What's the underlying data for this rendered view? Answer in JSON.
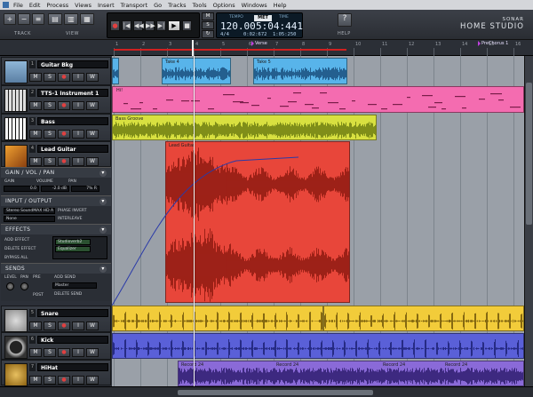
{
  "menu": [
    "File",
    "Edit",
    "Process",
    "Views",
    "Insert",
    "Transport",
    "Go",
    "Tracks",
    "Tools",
    "Options",
    "Windows",
    "Help"
  ],
  "toolbar": {
    "track_label": "TRACK",
    "view_label": "VIEW",
    "help_label": "HELP"
  },
  "transport": {
    "record": "●",
    "rewind": "|◀",
    "back": "◀◀",
    "forward": "▶▶",
    "end": "▶|",
    "play": "▶",
    "stop": "■",
    "loop": "↻",
    "metronome_m": "M",
    "metronome_s": "S"
  },
  "clock": {
    "tempo_label": "TEMPO",
    "met_label": "MET",
    "time_label": "TIME",
    "tempo_value": "120.00",
    "time_value": "5:04:441",
    "small_left": "4/4",
    "small_mid": "0:02:672",
    "small_right": "1:05:250"
  },
  "brand": {
    "line1": "SONAR",
    "line2": "HOME STUDIO"
  },
  "ruler": {
    "numbers": [
      "1",
      "2",
      "3",
      "4",
      "5",
      "6",
      "7",
      "8",
      "9",
      "10",
      "11",
      "12",
      "13",
      "14",
      "15",
      "16"
    ],
    "markers": [
      {
        "label": "Verse"
      },
      {
        "label": "PreChorus 1"
      }
    ]
  },
  "tracks": [
    {
      "num": "1",
      "name": "Guitar Bkg",
      "color": "#4aa3e8",
      "btn_m": "M",
      "btn_s": "S",
      "btn_r": "●",
      "btn_i": "I",
      "btn_w": "W"
    },
    {
      "num": "2",
      "name": "TTS-1 Instrument 1",
      "color": "#f06aa8",
      "btn_m": "M",
      "btn_s": "S",
      "btn_r": "●",
      "btn_i": "I",
      "btn_w": "W"
    },
    {
      "num": "3",
      "name": "Bass",
      "color": "#e0e040",
      "btn_m": "M",
      "btn_s": "S",
      "btn_r": "●",
      "btn_i": "I",
      "btn_w": "W"
    },
    {
      "num": "4",
      "name": "Lead Guitar",
      "color": "#e84030",
      "btn_m": "M",
      "btn_s": "S",
      "btn_r": "●",
      "btn_i": "I",
      "btn_w": "W"
    },
    {
      "num": "5",
      "name": "Snare",
      "color": "#f0d030",
      "btn_m": "M",
      "btn_s": "S",
      "btn_r": "●",
      "btn_i": "I",
      "btn_w": "W"
    },
    {
      "num": "6",
      "name": "Kick",
      "color": "#5a5ad8",
      "btn_m": "M",
      "btn_s": "S",
      "btn_r": "●",
      "btn_i": "I",
      "btn_w": "W"
    },
    {
      "num": "7",
      "name": "HiHat",
      "color": "#7a5ad0",
      "btn_m": "M",
      "btn_s": "S",
      "btn_r": "●",
      "btn_i": "I",
      "btn_w": "W"
    }
  ],
  "inspector": {
    "gain_header": "GAIN / VOL / PAN",
    "gain_label": "GAIN",
    "volume_label": "VOLUME",
    "pan_label": "PAN",
    "gain_value": "0.0",
    "volume_value": "-2.0 dB",
    "pan_value": "7% R",
    "io_header": "INPUT / OUTPUT",
    "input_value": "Stereo SoundMAX HD A",
    "phase_invert": "PHASE INVERT",
    "interleave": "INTERLEAVE",
    "output_value": "None",
    "effects_header": "EFFECTS",
    "add_effect": "ADD EFFECT",
    "delete_effect": "DELETE EFFECT",
    "bypass_all": "BYPASS ALL",
    "fx1": "Studioverb2",
    "fx2": "Equalizer",
    "sends_header": "SENDS",
    "send_level": "LEVEL",
    "send_pan": "PAN",
    "send_pre": "PRE",
    "send_post": "POST",
    "add_send": "ADD SEND",
    "delete_send": "DELETE SEND",
    "send_target": "Master"
  },
  "clip_labels": {
    "take4": "Take 4",
    "take5": "Take 5",
    "midi": "Hi!",
    "bass": "Bass Groove",
    "lead": "Lead Guitar",
    "record": "Record 24"
  },
  "colors": {
    "guitar_bkg": "#58b4ea",
    "midi": "#f46cb0",
    "bass": "#d8e040",
    "lead": "#e8463a",
    "snare": "#f2cc3a",
    "kick": "#5a60d8",
    "hihat": "#8a6ad8"
  }
}
